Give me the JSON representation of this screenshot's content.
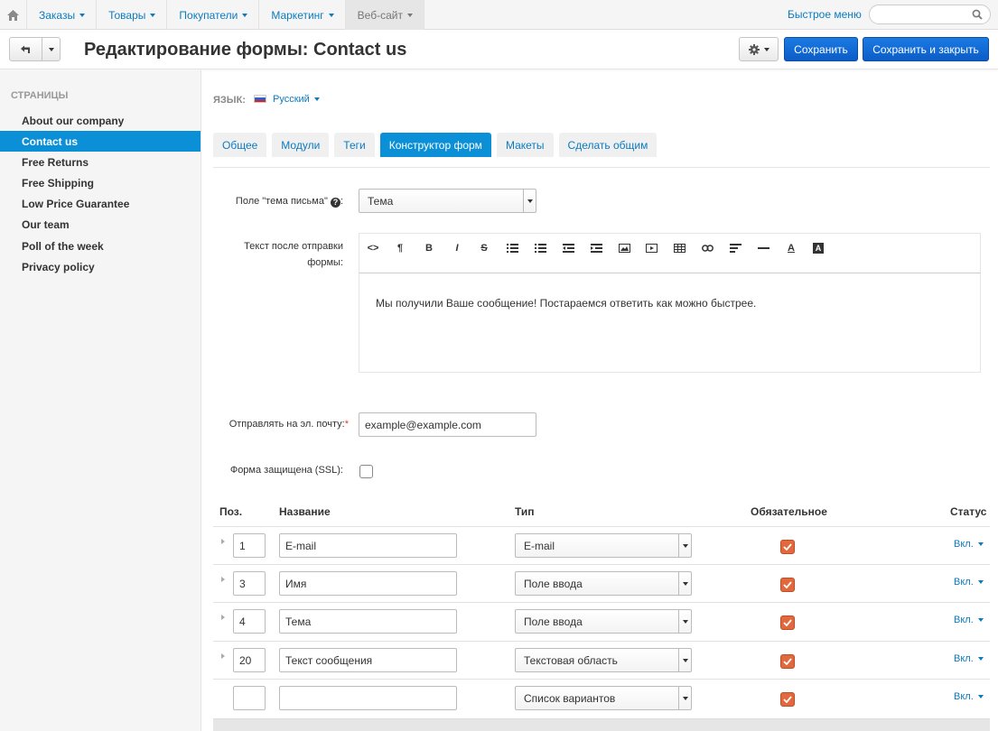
{
  "topnav": {
    "home_icon": "home-icon",
    "menu": [
      {
        "label": "Заказы"
      },
      {
        "label": "Товары"
      },
      {
        "label": "Покупатели"
      },
      {
        "label": "Маркетинг"
      },
      {
        "label": "Веб-сайт"
      }
    ],
    "quick_menu": "Быстрое меню",
    "search_placeholder": ""
  },
  "header": {
    "title": "Редактирование формы: Contact us",
    "save_label": "Сохранить",
    "save_close_label": "Сохранить и закрыть"
  },
  "sidebar": {
    "title": "Страницы",
    "items": [
      {
        "label": "About our company"
      },
      {
        "label": "Contact us"
      },
      {
        "label": "Free Returns"
      },
      {
        "label": "Free Shipping"
      },
      {
        "label": "Low Price Guarantee"
      },
      {
        "label": "Our team"
      },
      {
        "label": "Poll of the week"
      },
      {
        "label": "Privacy policy"
      }
    ]
  },
  "language": {
    "label": "ЯЗЫК:",
    "value": "Русский"
  },
  "tabs": [
    {
      "label": "Общее"
    },
    {
      "label": "Модули"
    },
    {
      "label": "Теги"
    },
    {
      "label": "Конструктор форм"
    },
    {
      "label": "Макеты"
    },
    {
      "label": "Сделать общим"
    }
  ],
  "form": {
    "subject_label": "Поле \"тема письма\"",
    "subject_value": "Тема",
    "after_send_label": "Текст после отправки формы:",
    "after_send_text": "Мы получили Ваше сообщение! Постараемся ответить как можно быстрее.",
    "email_label": "Отправлять на эл. почту:",
    "email_value": "example@example.com",
    "ssl_label": "Форма защищена (SSL):"
  },
  "table": {
    "headers": {
      "pos": "Поз.",
      "name": "Название",
      "type": "Тип",
      "required": "Обязательное",
      "status": "Статус"
    },
    "rows": [
      {
        "pos": "1",
        "name": "E-mail",
        "type": "E-mail",
        "status": "Вкл."
      },
      {
        "pos": "3",
        "name": "Имя",
        "type": "Поле ввода",
        "status": "Вкл."
      },
      {
        "pos": "4",
        "name": "Тема",
        "type": "Поле ввода",
        "status": "Вкл."
      },
      {
        "pos": "20",
        "name": "Текст сообщения",
        "type": "Текстовая область",
        "status": "Вкл."
      },
      {
        "pos": "",
        "name": "",
        "type": "Список вариантов",
        "status": "Вкл."
      }
    ]
  },
  "colors": {
    "accent": "#0b8fd6",
    "link": "#0b7bc1",
    "primary_button": "#0c5cc7",
    "checkbox_checked": "#e2693e"
  }
}
